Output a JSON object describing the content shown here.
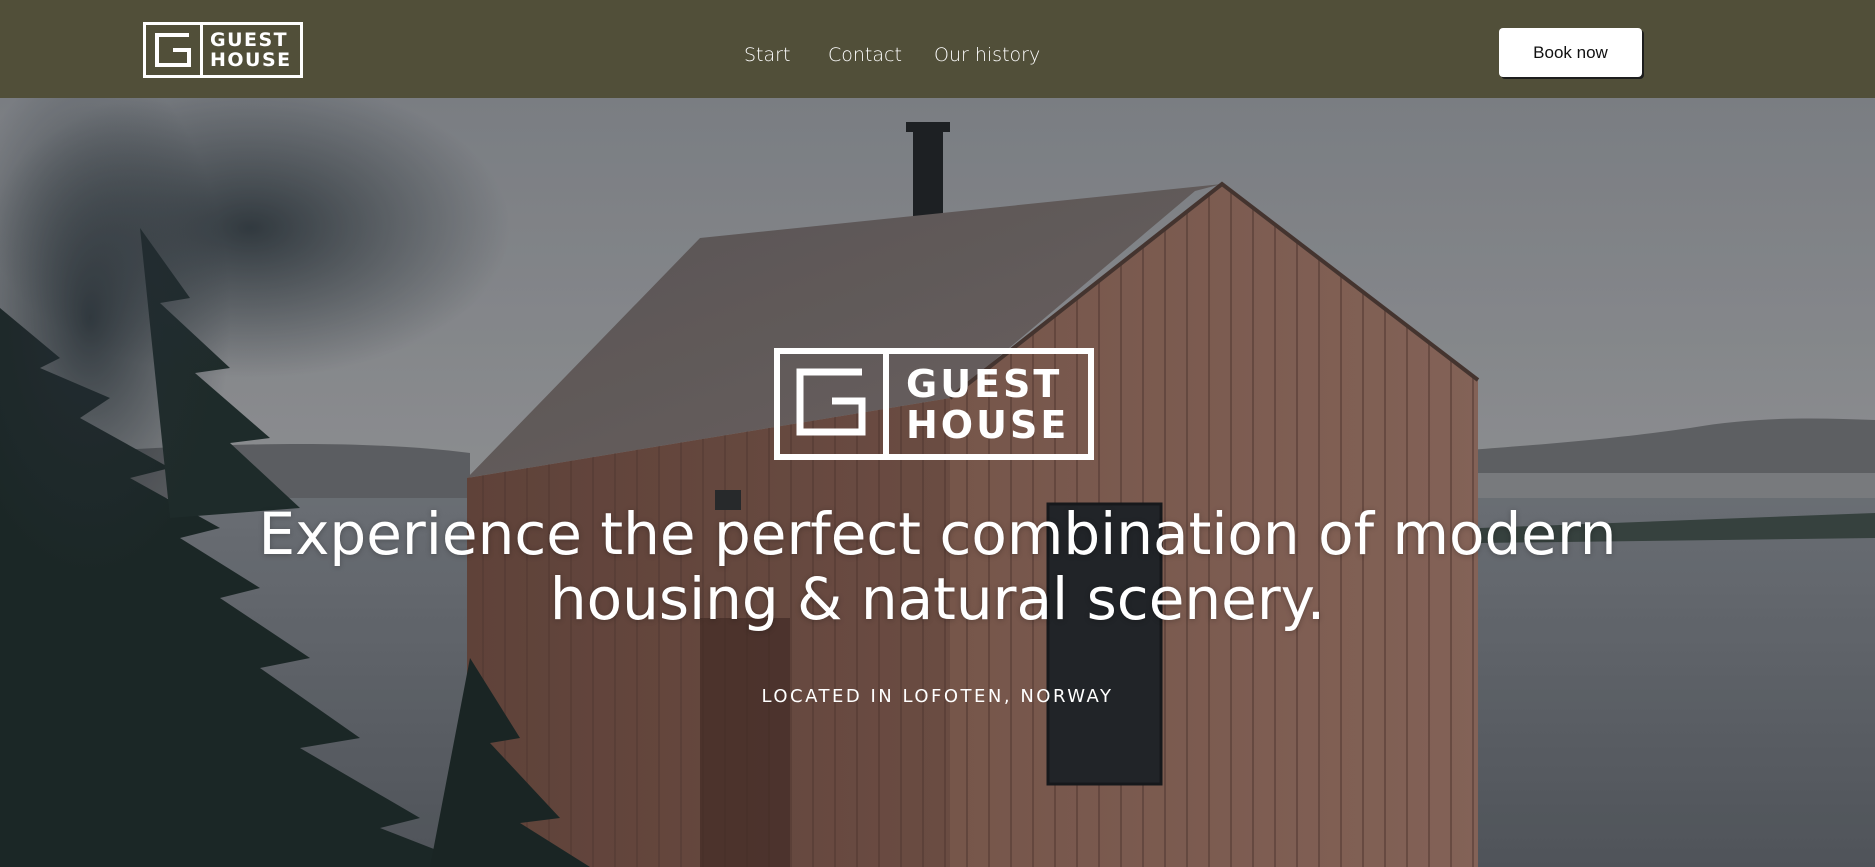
{
  "nav": {
    "logo": {
      "line1": "GUEST",
      "line2": "HOUSE"
    },
    "links": [
      {
        "label": "Start"
      },
      {
        "label": "Contact"
      },
      {
        "label": "Our history"
      }
    ],
    "cta": "Book now",
    "background": "#514f39"
  },
  "hero": {
    "logo": {
      "line1": "GUEST",
      "line2": "HOUSE"
    },
    "headline_line1": "Experience the perfect combination of modern",
    "headline_line2": "housing & natural scenery.",
    "subline": "LOCATED IN LOFOTEN, NORWAY",
    "image_subject": "wooden cabin by the water with pine trees"
  },
  "colors": {
    "nav_bg": "#514f39",
    "text": "#ffffff",
    "button_bg": "#ffffff",
    "button_text": "#111111"
  }
}
